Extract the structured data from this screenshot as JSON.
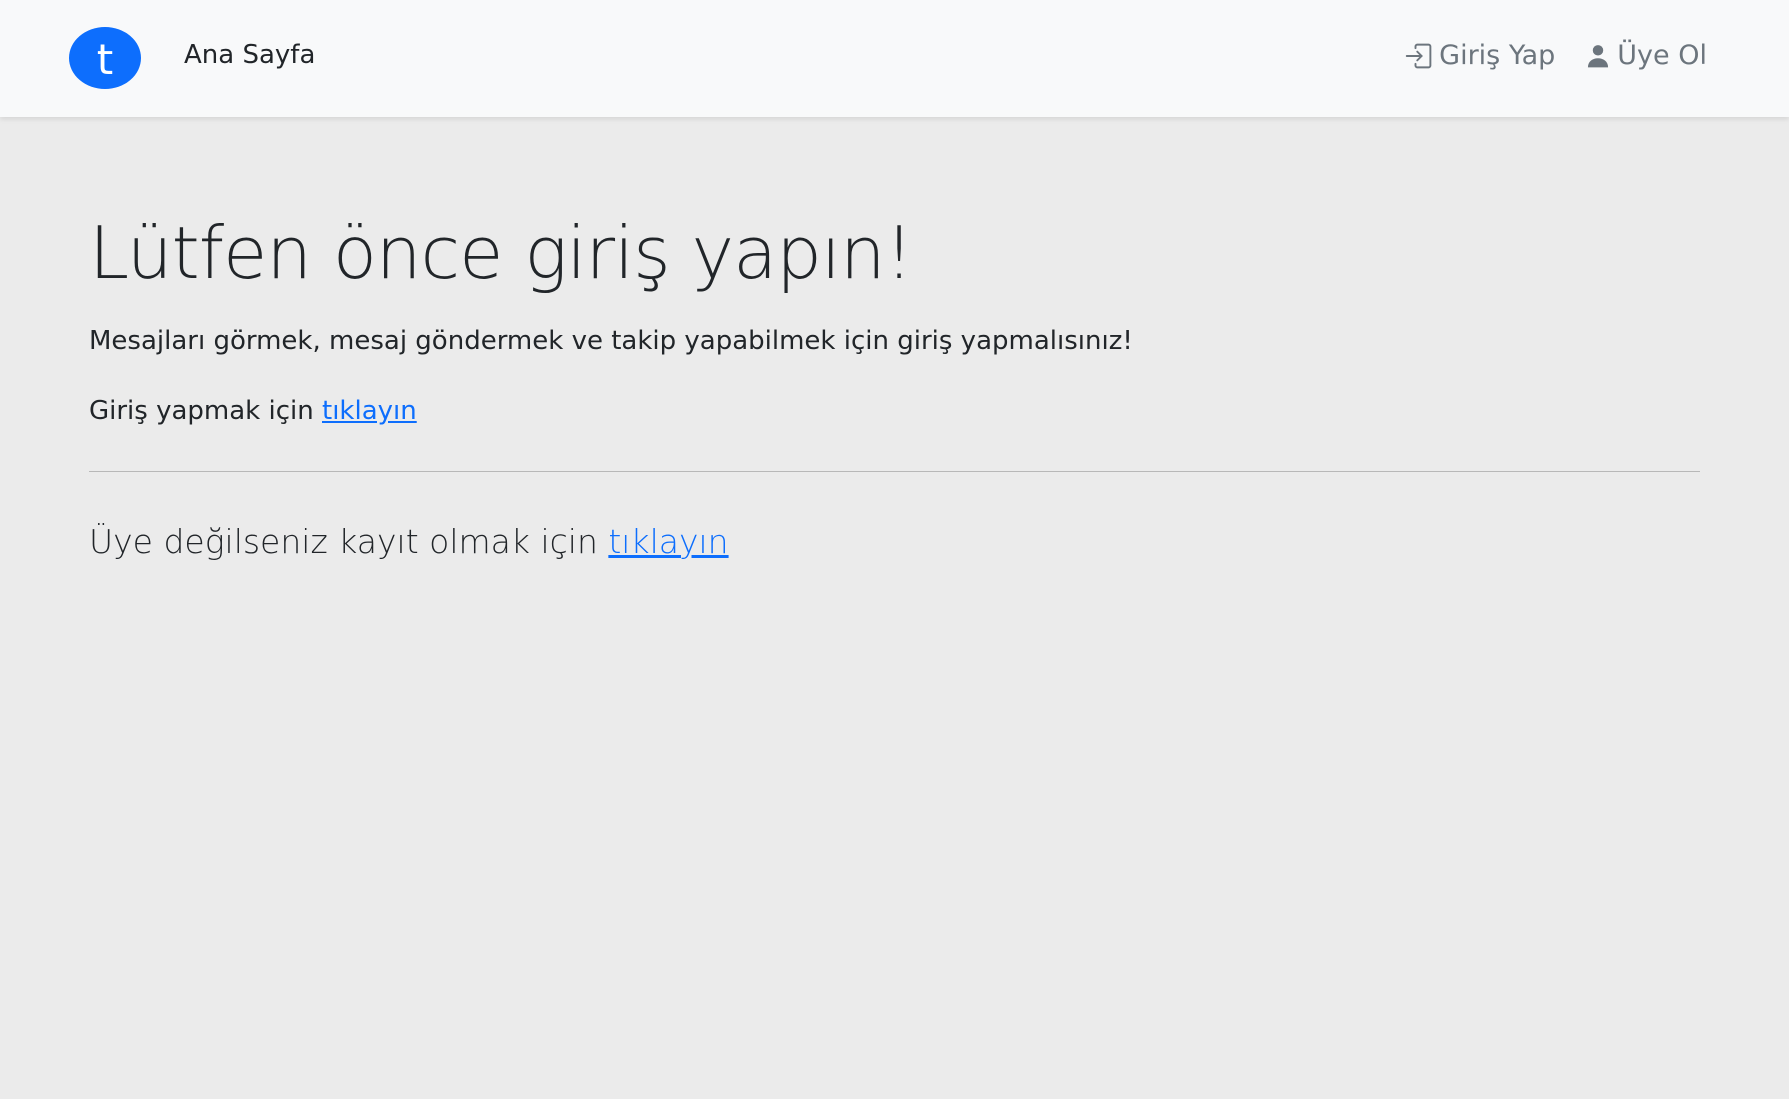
{
  "navbar": {
    "logo_letter": "t",
    "home_label": "Ana Sayfa",
    "login_label": "Giriş Yap",
    "register_label": "Üye Ol",
    "login_icon": "box-arrow-in-right-icon",
    "register_icon": "person-icon"
  },
  "main": {
    "title": "Lütfen önce giriş yapın!",
    "lead": "Mesajları görmek, mesaj göndermek ve takip yapabilmek için giriş yapmalısınız!",
    "login_prompt": "Giriş yapmak için",
    "login_link": "tıklayın",
    "register_prompt": "Üye değilseniz kayıt olmak için",
    "register_link": "tıklayın"
  },
  "colors": {
    "brand": "#0d6efd",
    "link": "#0d6efd",
    "nav_bg": "#f8f9fa",
    "page_bg": "#ebebeb",
    "muted": "#6c757d"
  }
}
